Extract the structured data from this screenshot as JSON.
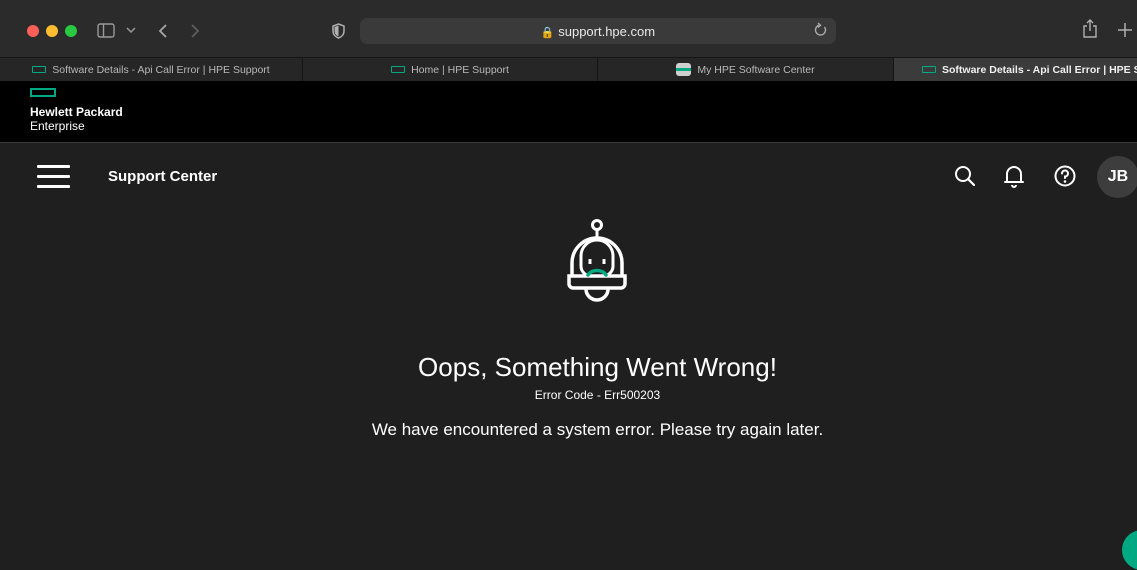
{
  "browser": {
    "url": "support.hpe.com",
    "tabs": [
      {
        "label": "Software Details - Api Call Error | HPE Support",
        "favicon": "hpe-icon"
      },
      {
        "label": "Home | HPE Support",
        "favicon": "hpe-icon"
      },
      {
        "label": "My HPE Software Center",
        "favicon": "software-center-icon"
      },
      {
        "label": "Software Details - Api Call Error | HPE Support",
        "favicon": "hpe-icon",
        "active": true
      }
    ]
  },
  "hpe_header": {
    "logo_line1": "Hewlett Packard",
    "logo_line2": "Enterprise",
    "brand_color": "#01a982"
  },
  "appbar": {
    "title": "Support Center",
    "avatar_initials": "JB",
    "icons": [
      "menu-icon",
      "search-icon",
      "bell-icon",
      "help-icon"
    ]
  },
  "error": {
    "title": "Oops, Something Went Wrong!",
    "code": "Error Code - Err500203",
    "message": "We have encountered a system error. Please try again later."
  }
}
